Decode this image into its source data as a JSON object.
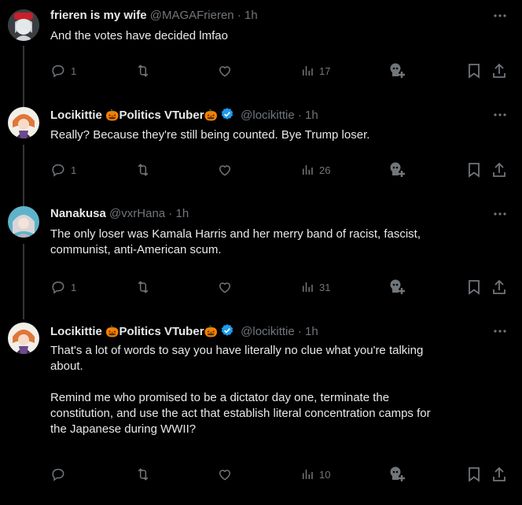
{
  "tweets": [
    {
      "name": "frieren is my wife",
      "name_emoji": "",
      "name_emoji2": "",
      "handle": "@MAGAFrieren",
      "time": "· 1h",
      "text": "And the votes have decided lmfao",
      "replies": "1",
      "retweets": "",
      "likes": "",
      "views": "17",
      "verified": false
    },
    {
      "name": "Locikittie ",
      "name_emoji": "🎃",
      "name_mid": "Politics VTuber",
      "name_emoji2": "🎃",
      "handle": "@locikittie",
      "time": "· 1h",
      "text": "Really? Because they're still being counted. Bye Trump loser.",
      "replies": "1",
      "retweets": "",
      "likes": "",
      "views": "26",
      "verified": true
    },
    {
      "name": "Nanakusa",
      "name_emoji": "",
      "name_emoji2": "",
      "handle": "@vxrHana",
      "time": "· 1h",
      "text": "The only loser was Kamala Harris and her merry band of racist, fascist,\ncommunist, anti-American scum.",
      "replies": "1",
      "retweets": "",
      "likes": "",
      "views": "31",
      "verified": false
    },
    {
      "name": "Locikittie ",
      "name_emoji": "🎃",
      "name_mid": "Politics VTuber",
      "name_emoji2": "🎃",
      "handle": "@locikittie",
      "time": "· 1h",
      "text": "That's a lot of words to say you have literally no clue what you're talking\nabout.\n\nRemind me who promised to be a dictator day one, terminate the\nconstitution, and use the act that establish literal concentration camps for\nthe Japanese during WWII?",
      "replies": "",
      "retweets": "",
      "likes": "",
      "views": "10",
      "verified": true
    }
  ],
  "colors": {
    "background": "#000000",
    "text": "#e7e9ea",
    "muted": "#71767b",
    "verified": "#1d9bf0"
  },
  "icons": [
    "reply-icon",
    "retweet-icon",
    "like-icon",
    "views-icon",
    "grok-icon",
    "bookmark-icon",
    "share-icon",
    "more-icon",
    "verified-badge-icon"
  ]
}
